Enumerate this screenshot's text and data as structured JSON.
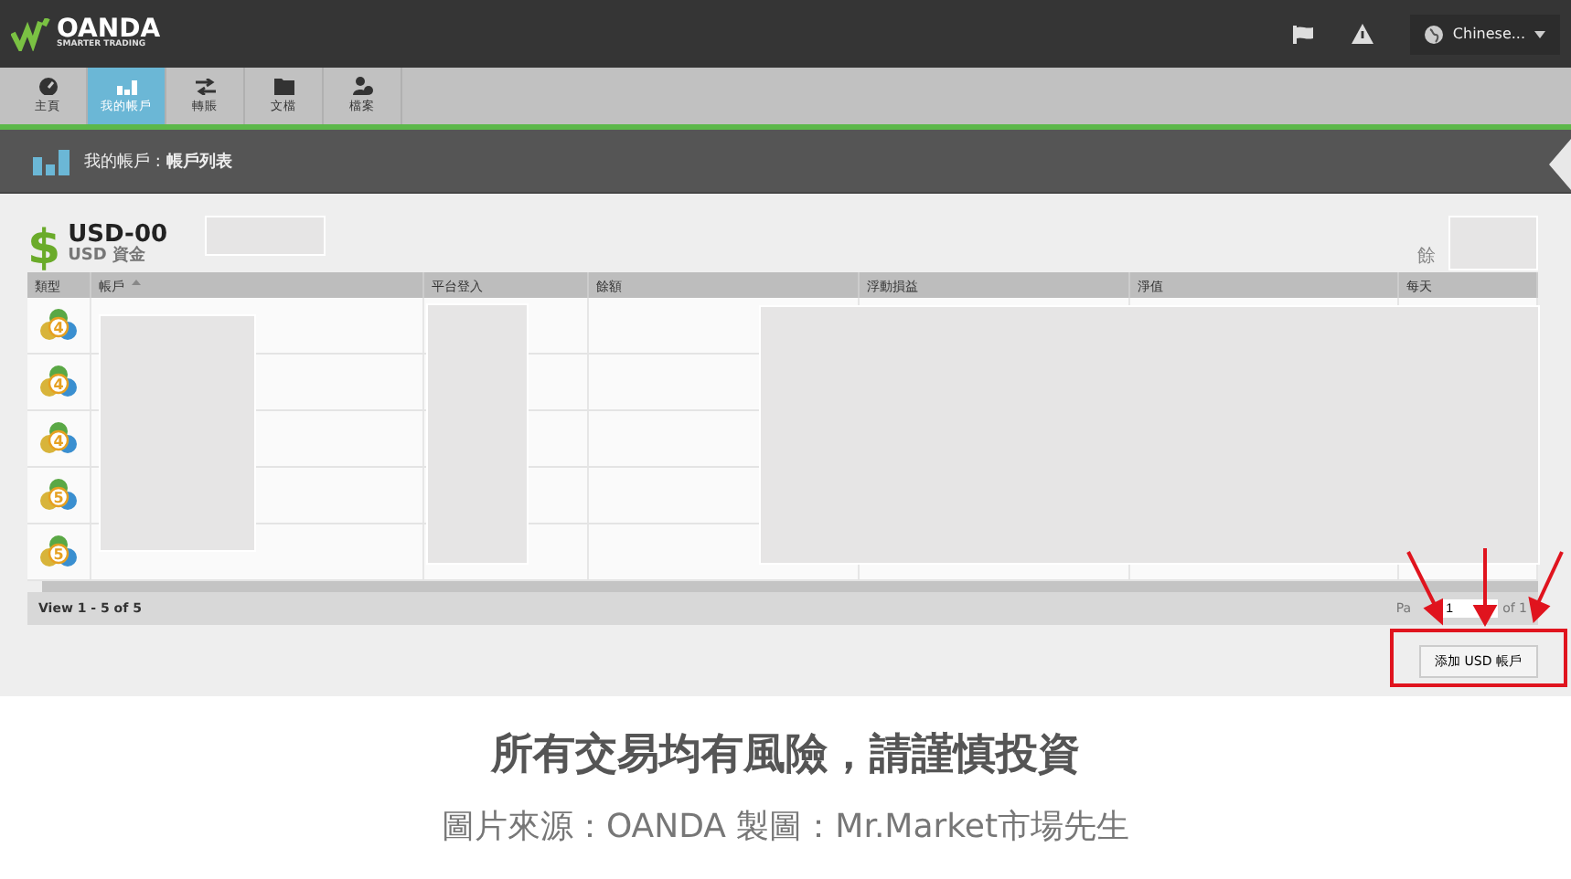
{
  "header": {
    "brand": "OANDA",
    "tagline": "SMARTER TRADING",
    "language": "Chinese..."
  },
  "nav": [
    {
      "label": "主頁",
      "selected": false
    },
    {
      "label": "我的帳戶",
      "selected": true
    },
    {
      "label": "轉賬",
      "selected": false
    },
    {
      "label": "文檔",
      "selected": false
    },
    {
      "label": "檔案",
      "selected": false
    }
  ],
  "breadcrumb": {
    "parent": "我的帳戶",
    "separator": ":",
    "current": "帳戶列表"
  },
  "account": {
    "currency_symbol": "$",
    "title": "USD-00",
    "subtitle": "USD 資金",
    "balance_label": "餘"
  },
  "table": {
    "columns": [
      {
        "label": "類型",
        "sorted": false
      },
      {
        "label": "帳戶",
        "sorted": true
      },
      {
        "label": "平台登入",
        "sorted": false
      },
      {
        "label": "餘額",
        "sorted": false
      },
      {
        "label": "浮動損益",
        "sorted": false
      },
      {
        "label": "淨值",
        "sorted": false
      },
      {
        "label": "每天",
        "sorted": false
      }
    ],
    "rows": [
      {
        "platform": "4"
      },
      {
        "platform": "4"
      },
      {
        "platform": "4"
      },
      {
        "platform": "5"
      },
      {
        "platform": "5"
      }
    ],
    "footer": "View 1 - 5 of 5",
    "page_label": "Pa",
    "page": "1",
    "page_total": "of 1"
  },
  "add_button": "添加 USD 帳戶",
  "caption": {
    "headline": "所有交易均有風險，請謹慎投資",
    "source": "圖片來源：OANDA 製圖：Mr.Market市場先生"
  }
}
